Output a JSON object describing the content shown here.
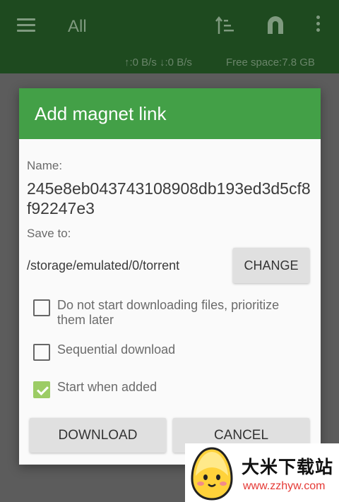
{
  "appbar": {
    "title": "All",
    "speeds": "↑:0 B/s ↓:0 B/s",
    "free_space": "Free space:7.8 GB",
    "icons": [
      "menu-icon",
      "sort-icon",
      "magnet-icon",
      "more-vert-icon"
    ]
  },
  "dialog": {
    "title": "Add magnet link",
    "name_label": "Name:",
    "name_value": "245e8eb043743108908db193ed3d5cf8f92247e3",
    "save_to_label": "Save to:",
    "save_path": "/storage/emulated/0/torrent",
    "change_label": "CHANGE",
    "options": [
      {
        "label": "Do not start downloading files, prioritize them later",
        "checked": false
      },
      {
        "label": "Sequential download",
        "checked": false
      },
      {
        "label": "Start when added",
        "checked": true
      }
    ],
    "download_label": "DOWNLOAD",
    "cancel_label": "CANCEL",
    "accent_color": "#43a047"
  },
  "watermark": {
    "name": "大米下载站",
    "url": "www.zzhyw.com"
  }
}
